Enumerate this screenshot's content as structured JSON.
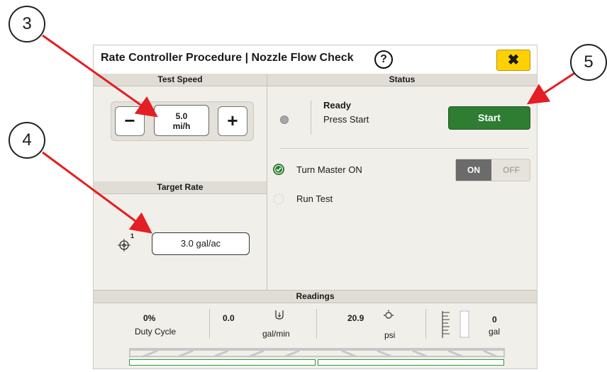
{
  "window": {
    "title": "Rate Controller Procedure | Nozzle Flow Check",
    "help_label": "?",
    "close_label": "✖"
  },
  "test_speed": {
    "header": "Test Speed",
    "minus_label": "−",
    "plus_label": "+",
    "value": "5.0",
    "unit": "mi/h"
  },
  "target_rate": {
    "header": "Target Rate",
    "section_badge": "1",
    "value": "3.0 gal/ac"
  },
  "status": {
    "header": "Status",
    "state": "Ready",
    "message": "Press Start",
    "start_label": "Start",
    "steps": [
      {
        "label": "Turn Master ON",
        "state": "complete"
      },
      {
        "label": "Run Test",
        "state": "pending"
      }
    ],
    "toggle": {
      "on_label": "ON",
      "off_label": "OFF",
      "selected": "ON"
    }
  },
  "readings": {
    "header": "Readings",
    "duty_cycle": {
      "value": "0%",
      "label": "Duty Cycle"
    },
    "flow": {
      "value": "0.0",
      "unit": "gal/min"
    },
    "pressure": {
      "value": "20.9",
      "unit": "psi"
    },
    "volume": {
      "value": "0",
      "unit": "gal"
    }
  },
  "callouts": [
    "3",
    "4",
    "5"
  ],
  "colors": {
    "accent_green": "#2e7d32",
    "close_yellow": "#ffd100",
    "arrow_red": "#e31e24"
  }
}
